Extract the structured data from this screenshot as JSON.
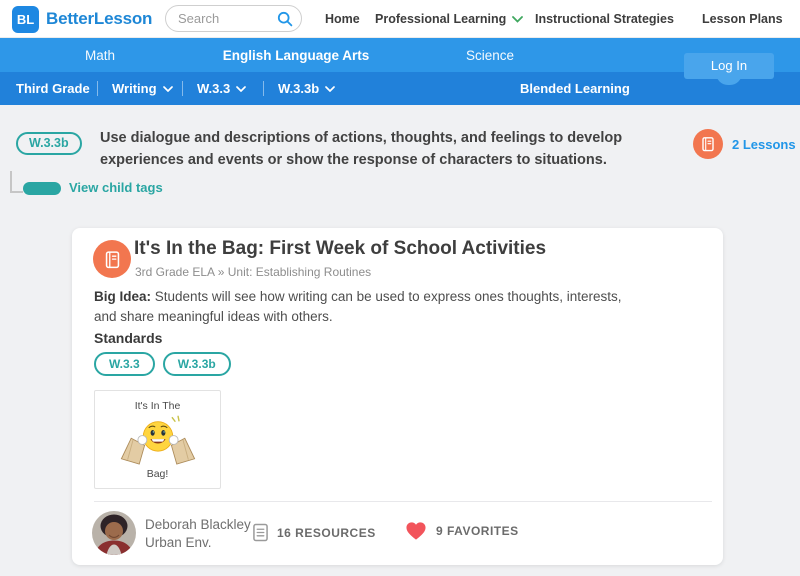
{
  "header": {
    "logo_text": "BL",
    "brand": "BetterLesson",
    "search_placeholder": "Search",
    "nav": [
      {
        "label": "Home"
      },
      {
        "label": "Professional Learning",
        "has_dropdown": true
      },
      {
        "label": "Instructional Strategies"
      },
      {
        "label": "Lesson Plans"
      }
    ]
  },
  "subjects": {
    "items": [
      {
        "label": "Math",
        "active": false
      },
      {
        "label": "English Language Arts",
        "active": true
      },
      {
        "label": "Science",
        "active": false
      }
    ],
    "login_label": "Log In"
  },
  "breadcrumbs": {
    "items": [
      {
        "label": "Third Grade",
        "has_dropdown": false
      },
      {
        "label": "Writing",
        "has_dropdown": true
      },
      {
        "label": "W.3.3",
        "has_dropdown": true
      },
      {
        "label": "W.3.3b",
        "has_dropdown": true
      }
    ],
    "right_label": "Blended Learning"
  },
  "standard": {
    "code": "W.3.3b",
    "description": "Use dialogue and descriptions of actions, thoughts, and feelings to develop\nexperiences and events or show the response of characters to situations.",
    "lessons_label": "2 Lessons",
    "view_child_tags": "View child tags"
  },
  "card": {
    "title": "It's In the Bag: First Week of School Activities",
    "subtitle": "3rd Grade ELA » Unit: Establishing Routines",
    "big_idea_label": "Big Idea:",
    "big_idea_text": "Students will see how writing can be used to express ones thoughts, interests,\nand share meaningful ideas with others.",
    "standards_label": "Standards",
    "standards": [
      "W.3.3",
      "W.3.3b"
    ],
    "thumbnail": {
      "line1": "It's In The",
      "line2": "Bag!"
    },
    "author": {
      "name": "Deborah Blackley",
      "affiliation": "Urban Env."
    },
    "resources_label": "16 RESOURCES",
    "favorites_label": "9 FAVORITES"
  },
  "icons": {
    "search": "magnifier",
    "nav_dropdown": "chevron-down",
    "lessons": "notebook-clipboard",
    "resources": "document-lines",
    "favorites": "heart",
    "toggle": "switch-on"
  },
  "colors": {
    "brand_blue": "#1e87d6",
    "subject_bar_blue": "#2e97e8",
    "breadcrumb_bar_blue": "#2181da",
    "login_blue": "#49a5ec",
    "teal": "#2aa6a3",
    "coral": "#f2764f",
    "link_blue": "#2196e8",
    "heart_red": "#f2545b",
    "chevron_green": "#3fa75f"
  }
}
